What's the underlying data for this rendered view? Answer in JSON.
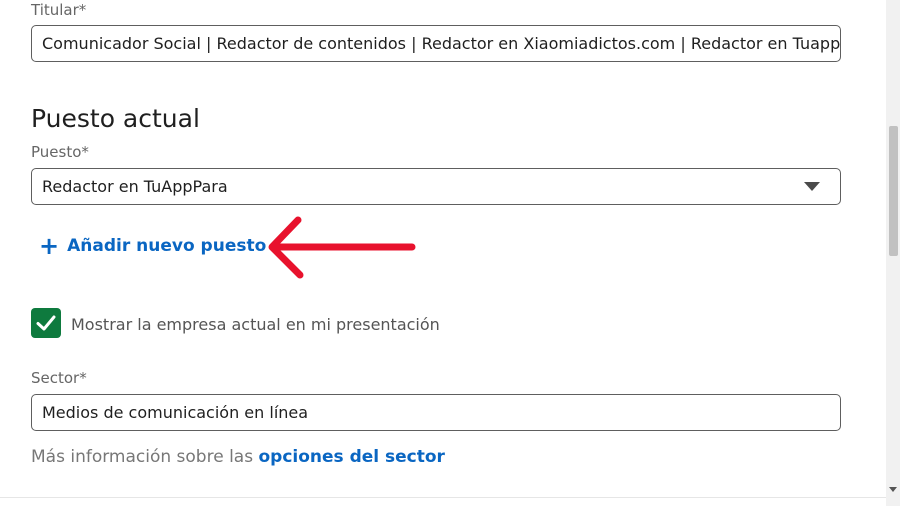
{
  "titular": {
    "label": "Titular*",
    "value": "Comunicador Social | Redactor de contenidos | Redactor en Xiaomiadictos.com | Redactor en Tuapppara"
  },
  "puesto_actual": {
    "section_title": "Puesto actual",
    "label": "Puesto*",
    "selected": "Redactor en TuAppPara",
    "add_link": "Añadir nuevo puesto"
  },
  "show_company": {
    "checked": true,
    "label": "Mostrar la empresa actual en mi presentación"
  },
  "sector": {
    "label": "Sector*",
    "value": "Medios de comunicación en línea",
    "info_text": "Más información sobre las ",
    "info_link": "opciones del sector"
  },
  "colors": {
    "link": "#0a66c2",
    "checkbox": "#0e7a3e",
    "arrow": "#e8122d"
  },
  "icons": {
    "dropdown": "chevron-down-icon",
    "add": "plus-icon",
    "check": "check-icon"
  }
}
